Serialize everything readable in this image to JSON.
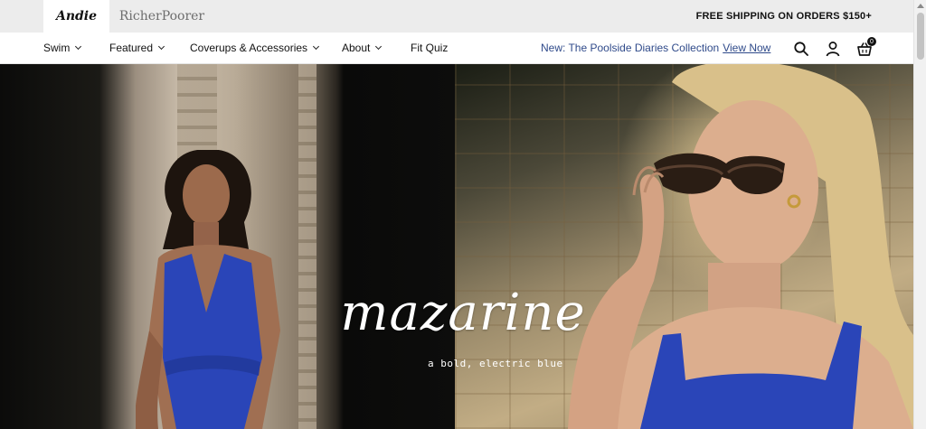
{
  "brands": {
    "andie": "Andie",
    "richer_poorer": "RicherPoorer"
  },
  "announcement": {
    "shipping": "FREE SHIPPING ON ORDERS $150+"
  },
  "nav": {
    "items": [
      {
        "label": "Swim",
        "has_dropdown": true
      },
      {
        "label": "Featured",
        "has_dropdown": true
      },
      {
        "label": "Coverups & Accessories",
        "has_dropdown": true
      },
      {
        "label": "About",
        "has_dropdown": true
      },
      {
        "label": "Fit Quiz",
        "has_dropdown": false
      }
    ],
    "promo_text": "New: The Poolside Diaries Collection",
    "promo_link": "View Now",
    "icons": [
      "search-icon",
      "account-icon",
      "cart-icon"
    ],
    "cart_count": "0"
  },
  "hero": {
    "title": "mazarine",
    "subtitle": "a bold, electric blue"
  },
  "colors": {
    "topbar_bg": "#ececec",
    "promo_blue": "#2f4a8a",
    "swimsuit_blue": "#2a45b8"
  }
}
